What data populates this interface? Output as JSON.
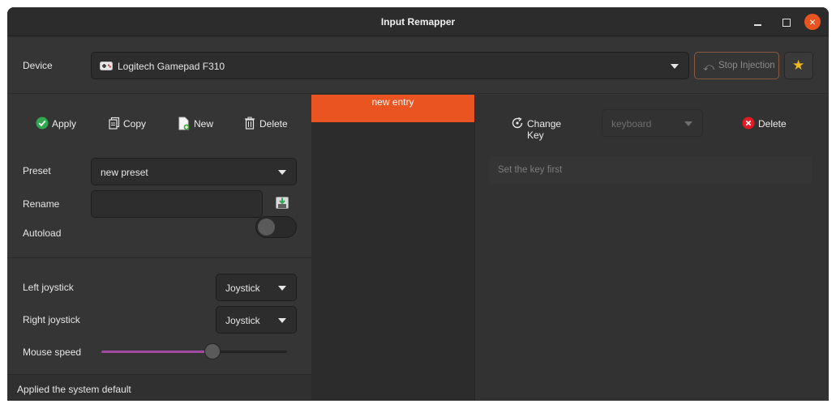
{
  "window": {
    "title": "Input Remapper"
  },
  "device": {
    "label": "Device",
    "selected": "Logitech Gamepad F310",
    "stop_injection_label": "Stop Injection"
  },
  "toolbar": {
    "apply_label": "Apply",
    "copy_label": "Copy",
    "new_label": "New",
    "delete_label": "Delete"
  },
  "preset": {
    "label": "Preset",
    "selected": "new preset",
    "rename_label": "Rename",
    "rename_value": "",
    "autoload_label": "Autoload",
    "autoload_on": false
  },
  "joysticks": {
    "left_label": "Left joystick",
    "left_value": "Joystick",
    "right_label": "Right joystick",
    "right_value": "Joystick",
    "mouse_speed_label": "Mouse speed",
    "mouse_speed_fraction": 0.6
  },
  "status": {
    "text": "Applied the system default"
  },
  "mappings": {
    "entries": [
      "new entry"
    ]
  },
  "editor": {
    "change_key_label": "Change Key",
    "target_placeholder": "keyboard",
    "delete_label": "Delete",
    "key_hint": "Set the key first"
  },
  "colors": {
    "accent": "#e95420",
    "slider_fill": "#a349a4",
    "apply_icon": "#2fa84f",
    "delete_icon": "#e01b24",
    "star": "#f2b81b"
  },
  "icons": {
    "device": "gamepad-icon",
    "stop": "stop-injection-icon",
    "favorite": "star-icon",
    "apply": "check-circle-icon",
    "copy": "copy-icon",
    "new": "new-document-icon",
    "delete": "trash-icon",
    "save": "save-icon",
    "change_key": "record-key-icon",
    "remove": "delete-circle-icon"
  }
}
